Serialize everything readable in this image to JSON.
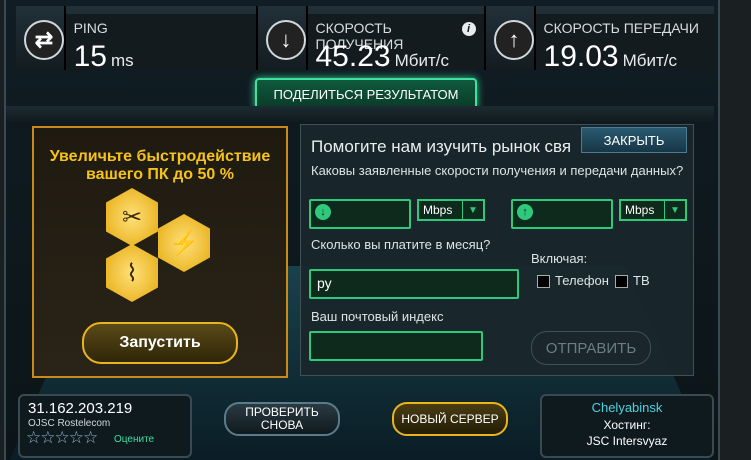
{
  "stats": {
    "ping": {
      "label": "PING",
      "value": "15",
      "unit": "ms"
    },
    "download": {
      "label": "СКОРОСТЬ ПОЛУЧЕНИЯ",
      "value": "45.23",
      "unit": "Мбит/с",
      "info": "i"
    },
    "upload": {
      "label": "СКОРОСТЬ ПЕРЕДАЧИ",
      "value": "19.03",
      "unit": "Мбит/с"
    }
  },
  "share_label": "ПОДЕЛИТЬСЯ РЕЗУЛЬТАТОМ",
  "promo": {
    "title_line1": "Увеличьте быстродействие",
    "title_line2": "вашего ПК до 50 %",
    "run_label": "Запустить"
  },
  "survey": {
    "title": "Помогите нам изучить рынок свя",
    "close_label": "ЗАКРЫТЬ",
    "q_speed": "Каковы заявленные скорости получения и передачи данных?",
    "unit_down": "Mbps",
    "unit_up": "Mbps",
    "q_pay": "Сколько вы платите в месяц?",
    "pay_prefix": "ру",
    "including": "Включая:",
    "phone": "Телефон",
    "tv": "ТВ",
    "q_zip": "Ваш почтовый индекс",
    "send_label": "ОТПРАВИТЬ"
  },
  "bottom": {
    "ip": "31.162.203.219",
    "isp": "OJSC Rostelecom",
    "rate_label": "Оцените",
    "stars": "☆☆☆☆☆",
    "retest_label": "ПРОВЕРИТЬ СНОВА",
    "new_server_label": "НОВЫЙ СЕРВЕР",
    "city": "Chelyabinsk",
    "hosting_label": "Хостинг:",
    "host": "JSC Intersvyaz"
  },
  "colors": {
    "accent_green": "#2fc97c",
    "accent_gold": "#f5c21a",
    "teal": "#4fd1e0"
  }
}
